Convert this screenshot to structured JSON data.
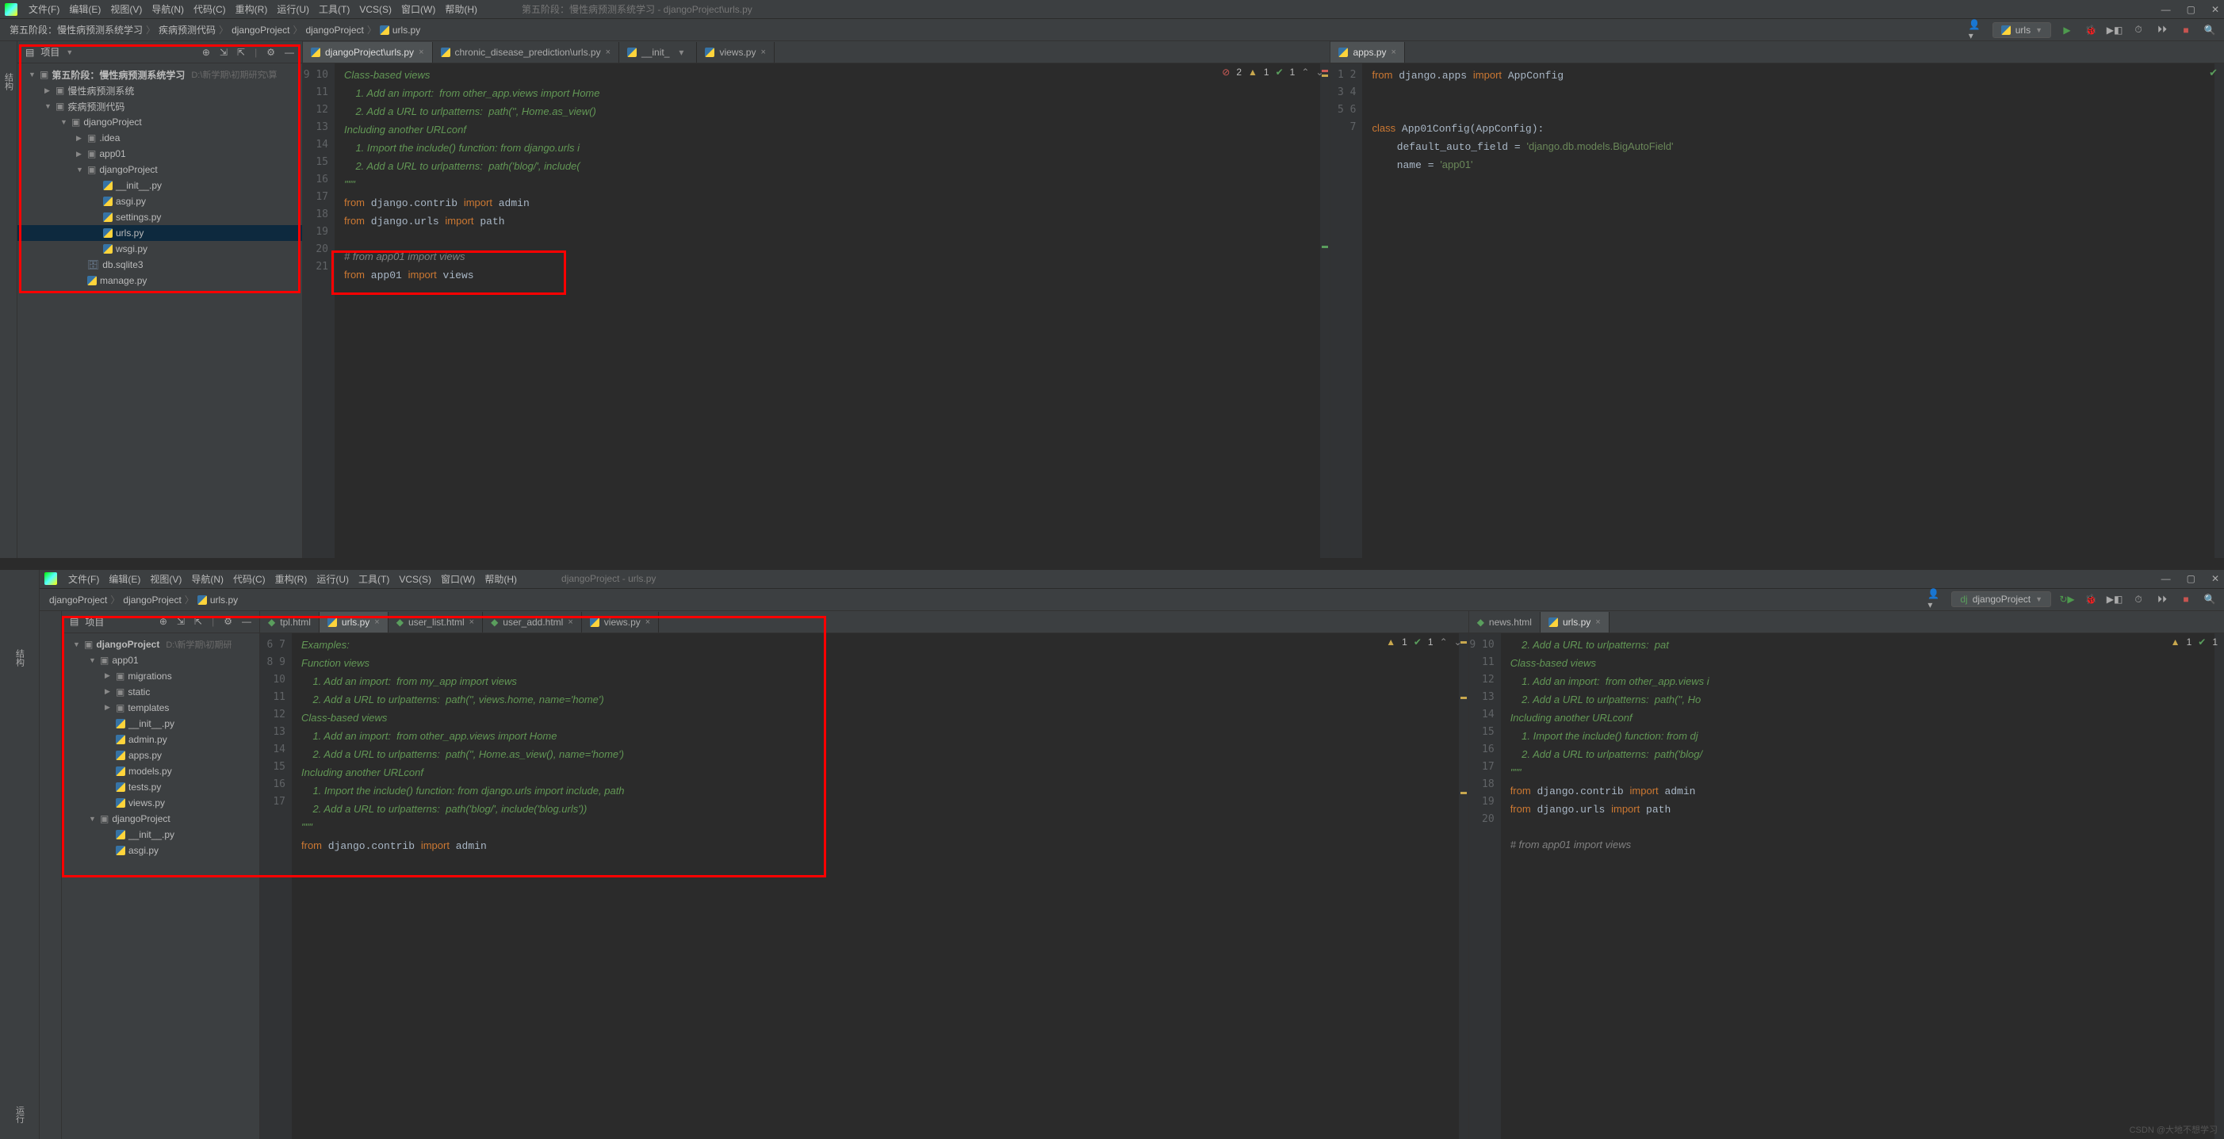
{
  "menus": [
    "文件(F)",
    "编辑(E)",
    "视图(V)",
    "导航(N)",
    "代码(C)",
    "重构(R)",
    "运行(U)",
    "工具(T)",
    "VCS(S)",
    "窗口(W)",
    "帮助(H)"
  ],
  "top": {
    "window_title": "第五阶段：慢性病预测系统学习 - djangoProject\\urls.py",
    "breadcrumbs": [
      "第五阶段：慢性病预测系统学习",
      "疾病预测代码",
      "djangoProject",
      "djangoProject",
      "urls.py"
    ],
    "run_config": "urls",
    "project_label": "项目",
    "root_name": "第五阶段：慢性病预测系统学习",
    "root_path": "D:\\新学期\\初期研究\\算",
    "tree": [
      {
        "n": "慢性病预测系统",
        "d": 1,
        "t": "dir",
        "k": "▶"
      },
      {
        "n": "疾病预测代码",
        "d": 1,
        "t": "dir",
        "k": "▼"
      },
      {
        "n": "djangoProject",
        "d": 2,
        "t": "dir",
        "k": "▼"
      },
      {
        "n": ".idea",
        "d": 3,
        "t": "dir",
        "k": "▶"
      },
      {
        "n": "app01",
        "d": 3,
        "t": "dir",
        "k": "▶"
      },
      {
        "n": "djangoProject",
        "d": 3,
        "t": "dir",
        "k": "▼"
      },
      {
        "n": "__init__.py",
        "d": 4,
        "t": "py"
      },
      {
        "n": "asgi.py",
        "d": 4,
        "t": "py"
      },
      {
        "n": "settings.py",
        "d": 4,
        "t": "py"
      },
      {
        "n": "urls.py",
        "d": 4,
        "t": "py",
        "sel": true
      },
      {
        "n": "wsgi.py",
        "d": 4,
        "t": "py"
      },
      {
        "n": "db.sqlite3",
        "d": 3,
        "t": "db"
      },
      {
        "n": "manage.py",
        "d": 3,
        "t": "py"
      }
    ],
    "left_tabs": [
      {
        "l": "djangoProject\\urls.py",
        "icon": "py",
        "active": true,
        "close": true
      },
      {
        "l": "chronic_disease_prediction\\urls.py",
        "icon": "py",
        "close": true
      },
      {
        "l": "__init_",
        "icon": "py",
        "caret": true
      },
      {
        "l": "views.py",
        "icon": "py",
        "close": true
      }
    ],
    "right_tabs": [
      {
        "l": "apps.py",
        "icon": "py",
        "active": true,
        "close": true
      }
    ],
    "left_lines_start": 9,
    "left_code": [
      {
        "t": "doc",
        "s": "Class-based views"
      },
      {
        "t": "doc",
        "s": "    1. Add an import:  from other_app.views import Home"
      },
      {
        "t": "doc",
        "s": "    2. Add a URL to urlpatterns:  path('', Home.as_view()"
      },
      {
        "t": "doc",
        "s": "Including another URLconf"
      },
      {
        "t": "doc",
        "s": "    1. Import the include() function: from django.urls i"
      },
      {
        "t": "doc",
        "s": "    2. Add a URL to urlpatterns:  path('blog/', include("
      },
      {
        "t": "doc",
        "s": "\"\"\""
      },
      {
        "t": "code",
        "s": "from django.contrib import admin"
      },
      {
        "t": "code",
        "s": "from django.urls import path"
      },
      {
        "t": "blank",
        "s": ""
      },
      {
        "t": "cmt",
        "s": "# from app01 import views"
      },
      {
        "t": "code",
        "s": "from app01 import views"
      },
      {
        "t": "blank",
        "s": ""
      }
    ],
    "left_marks": {
      "err": 2,
      "warn": 1,
      "ok": 1
    },
    "right_lines": [
      1,
      2,
      3,
      4,
      5,
      6,
      7
    ],
    "right_code": "from django.apps import AppConfig\n\n\nclass App01Config(AppConfig):\n    default_auto_field = 'django.db.models.BigAutoField'\n    name = 'app01'\n"
  },
  "bottom": {
    "window_title": "djangoProject - urls.py",
    "breadcrumbs": [
      "djangoProject",
      "djangoProject",
      "urls.py"
    ],
    "run_config": "djangoProject",
    "project_label": "项目",
    "root_name": "djangoProject",
    "root_path": "D:\\新学期\\初期研",
    "tree": [
      {
        "n": "app01",
        "d": 1,
        "t": "dir",
        "k": "▼"
      },
      {
        "n": "migrations",
        "d": 2,
        "t": "dir",
        "k": "▶"
      },
      {
        "n": "static",
        "d": 2,
        "t": "dir",
        "k": "▶"
      },
      {
        "n": "templates",
        "d": 2,
        "t": "dir",
        "k": "▶"
      },
      {
        "n": "__init__.py",
        "d": 2,
        "t": "py"
      },
      {
        "n": "admin.py",
        "d": 2,
        "t": "py"
      },
      {
        "n": "apps.py",
        "d": 2,
        "t": "py"
      },
      {
        "n": "models.py",
        "d": 2,
        "t": "py"
      },
      {
        "n": "tests.py",
        "d": 2,
        "t": "py"
      },
      {
        "n": "views.py",
        "d": 2,
        "t": "py"
      },
      {
        "n": "djangoProject",
        "d": 1,
        "t": "dir",
        "k": "▼"
      },
      {
        "n": "__init__.py",
        "d": 2,
        "t": "py"
      },
      {
        "n": "asgi.py",
        "d": 2,
        "t": "py"
      }
    ],
    "left_tabs": [
      {
        "l": "tpl.html",
        "icon": "html"
      },
      {
        "l": "urls.py",
        "icon": "py",
        "close": true,
        "active": true
      },
      {
        "l": "user_list.html",
        "icon": "html",
        "close": true
      },
      {
        "l": "user_add.html",
        "icon": "html",
        "close": true
      },
      {
        "l": "views.py",
        "icon": "py",
        "close": true
      }
    ],
    "right_tabs": [
      {
        "l": "news.html",
        "icon": "html"
      },
      {
        "l": "urls.py",
        "icon": "py",
        "close": true,
        "active": true
      }
    ],
    "left_lines_start": 6,
    "left_code": [
      {
        "t": "doc",
        "s": "Examples:"
      },
      {
        "t": "doc",
        "s": "Function views"
      },
      {
        "t": "doc",
        "s": "    1. Add an import:  from my_app import views"
      },
      {
        "t": "doc",
        "s": "    2. Add a URL to urlpatterns:  path('', views.home, name='home')"
      },
      {
        "t": "doc",
        "s": "Class-based views"
      },
      {
        "t": "doc",
        "s": "    1. Add an import:  from other_app.views import Home"
      },
      {
        "t": "doc",
        "s": "    2. Add a URL to urlpatterns:  path('', Home.as_view(), name='home')"
      },
      {
        "t": "doc",
        "s": "Including another URLconf"
      },
      {
        "t": "doc",
        "s": "    1. Import the include() function: from django.urls import include, path"
      },
      {
        "t": "doc",
        "s": "    2. Add a URL to urlpatterns:  path('blog/', include('blog.urls'))"
      },
      {
        "t": "doc",
        "s": "\"\"\""
      },
      {
        "t": "code",
        "s": "from django.contrib import admin"
      }
    ],
    "left_marks": {
      "warn": 1,
      "ok": 1
    },
    "right_lines_start": 9,
    "right_code": [
      {
        "t": "doc",
        "s": "    2. Add a URL to urlpatterns:  pat"
      },
      {
        "t": "doc",
        "s": "Class-based views"
      },
      {
        "t": "doc",
        "s": "    1. Add an import:  from other_app.views i"
      },
      {
        "t": "doc",
        "s": "    2. Add a URL to urlpatterns:  path('', Ho"
      },
      {
        "t": "doc",
        "s": "Including another URLconf"
      },
      {
        "t": "doc",
        "s": "    1. Import the include() function: from dj"
      },
      {
        "t": "doc",
        "s": "    2. Add a URL to urlpatterns:  path('blog/"
      },
      {
        "t": "doc",
        "s": "\"\"\""
      },
      {
        "t": "code",
        "s": "from django.contrib import admin"
      },
      {
        "t": "code",
        "s": "from django.urls import path"
      },
      {
        "t": "blank",
        "s": ""
      },
      {
        "t": "cmt",
        "s": "# from app01 import views"
      }
    ],
    "right_marks": {
      "warn": 1,
      "ok": 1
    },
    "watermark": "CSDN @大地不想学习"
  },
  "side_label_top": "结构",
  "side_label_bottom": "运行"
}
